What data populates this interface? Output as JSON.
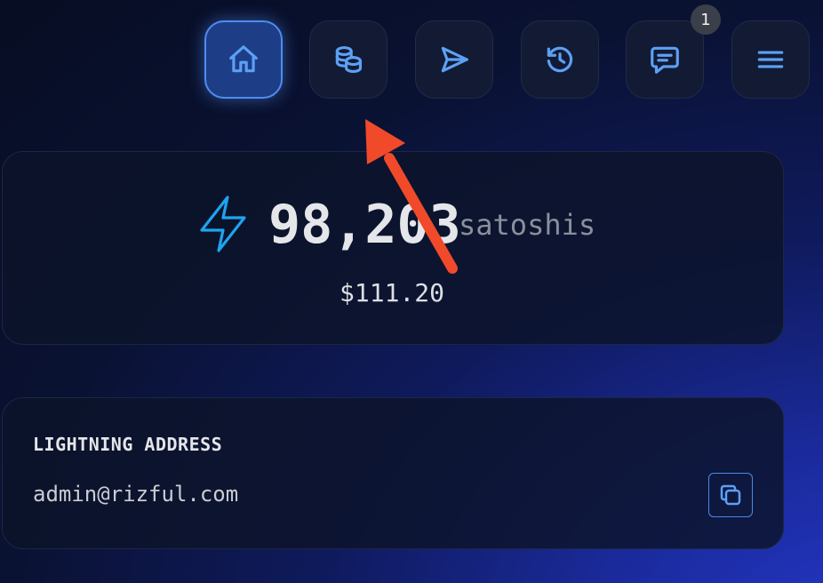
{
  "nav": {
    "items": [
      {
        "icon": "home-icon",
        "active": true
      },
      {
        "icon": "coins-icon",
        "active": false
      },
      {
        "icon": "send-icon",
        "active": false
      },
      {
        "icon": "history-icon",
        "active": false
      },
      {
        "icon": "message-icon",
        "active": false,
        "badge": "1"
      },
      {
        "icon": "menu-icon",
        "active": false
      }
    ]
  },
  "balance": {
    "amount": "98,203",
    "unit": "satoshis",
    "fiat": "$111.20"
  },
  "address": {
    "label": "LIGHTNING ADDRESS",
    "value": "admin@rizful.com"
  },
  "colors": {
    "accent": "#5da0f5",
    "bolt": "#1ea4f0",
    "annotation_arrow": "#f04a2a"
  }
}
